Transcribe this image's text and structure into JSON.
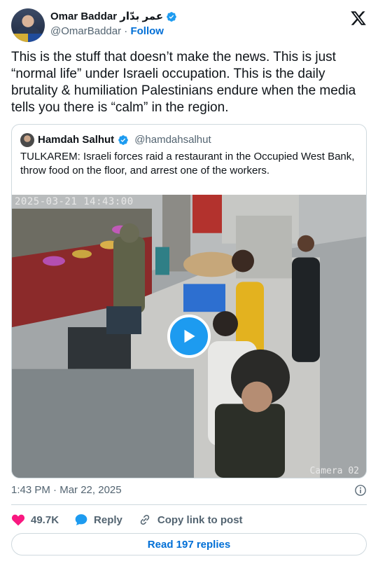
{
  "author": {
    "name": "Omar Baddar عمر بدّار",
    "handle": "@OmarBaddar",
    "separator": "·",
    "follow_label": "Follow"
  },
  "tweet": {
    "text": "This is the stuff that doesn’t make the news. This is just “normal life” under Israeli occupation. This is the daily brutality & humiliation Palestinians endure when the media tells you there is “calm” in the region."
  },
  "quoted": {
    "name": "Hamdah Salhut",
    "handle": "@hamdahsalhut",
    "text": "TULKAREM: Israeli forces raid a restaurant in the Occupied West Bank, throw food on the floor, and arrest one of the workers.",
    "video": {
      "timestamp_overlay": "2025-03-21 14:43:00",
      "camera_overlay": "Camera 02"
    }
  },
  "meta": {
    "time": "1:43 PM",
    "separator": "·",
    "date": "Mar 22, 2025"
  },
  "actions": {
    "likes": "49.7K",
    "reply_label": "Reply",
    "copy_label": "Copy link to post"
  },
  "read_replies_label": "Read 197 replies",
  "colors": {
    "accent": "#1d9bf0",
    "link": "#006fd6",
    "heart": "#f91880",
    "muted": "#536471",
    "border": "#cfd9de"
  },
  "icons": {
    "brand": "x-logo-icon",
    "verified": "verified-badge-icon",
    "play": "play-icon",
    "info": "info-icon",
    "like": "heart-icon",
    "reply": "reply-bubble-icon",
    "copy": "link-icon"
  }
}
